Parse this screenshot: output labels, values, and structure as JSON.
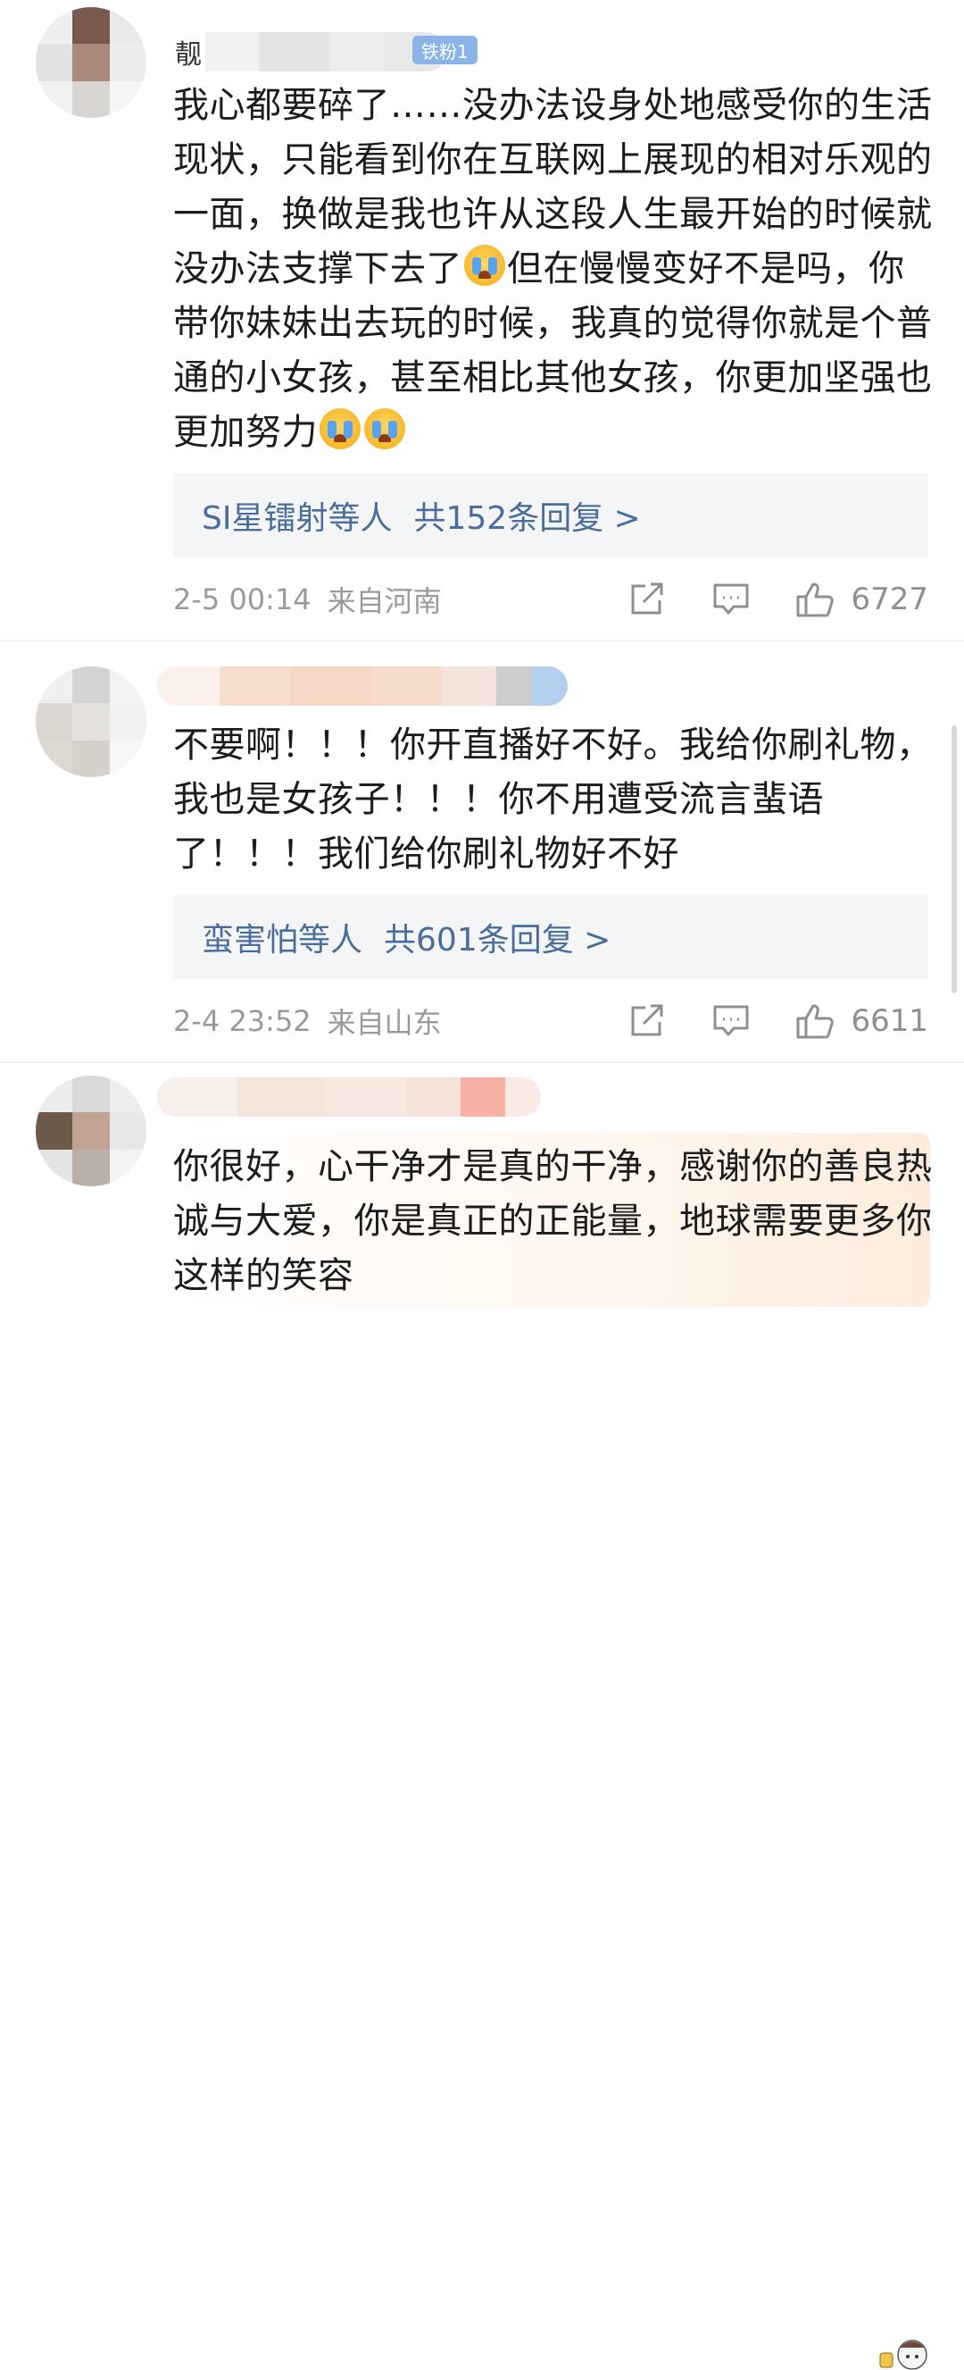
{
  "comments": [
    {
      "username_visible": "靓",
      "fan_badge": "铁粉1",
      "text_before_emoji": "我心都要碎了……没办法设身处地感受你的生活现状，只能看到你在互联网上展现的相对乐观的一面，换做是我也许从这段人生最开始的时候就没办法支撑下去了",
      "text_middle": "但在慢慢变好不是吗，你带你妹妹出去玩的时候，我真的觉得你就是个普通的小女孩，甚至相比其他女孩，你更加坚强也更加努力",
      "emoji": "crying-emoji",
      "reply_users": "SI星镭射等人",
      "reply_count": "共152条回复 >",
      "time": "2-5 00:14",
      "location": "来自河南",
      "likes": "6727"
    },
    {
      "text": "不要啊！！！你开直播好不好。我给你刷礼物，我也是女孩子！！！你不用遭受流言蜚语了！！！我们给你刷礼物好不好",
      "reply_users": "蛮害怕等人",
      "reply_count": "共601条回复 >",
      "time": "2-4 23:52",
      "location": "来自山东",
      "likes": "6611"
    },
    {
      "text": "你很好，心干净才是真的干净，感谢你的善良热诚与大爱，你是真正的正能量，地球需要更多你这样的笑容"
    }
  ],
  "icons": {
    "share": "share-icon",
    "comment": "comment-icon",
    "like": "thumbs-up-icon"
  },
  "colors": {
    "link": "#4a6d9c",
    "meta": "#9a9a9a",
    "badge": "#8ab4e8"
  }
}
